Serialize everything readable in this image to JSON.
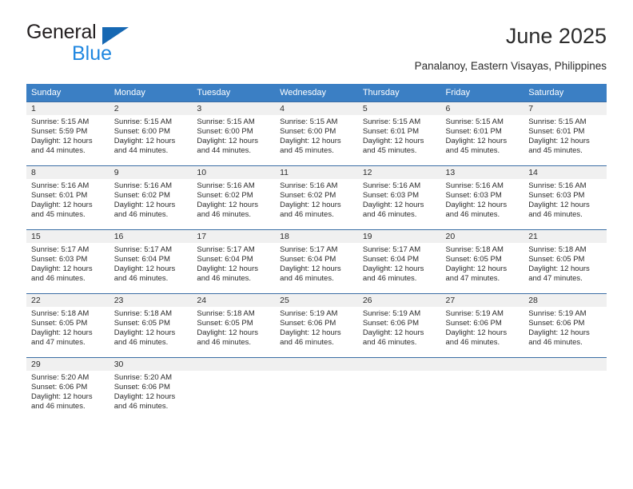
{
  "logo": {
    "primary_text": "General",
    "secondary_text": "Blue",
    "primary_color": "#231f20",
    "secondary_color": "#1f87e0",
    "triangle_color": "#1668b3",
    "icon": "triangle-flag-icon"
  },
  "header": {
    "title": "June 2025",
    "subtitle": "Panalanoy, Eastern Visayas, Philippines"
  },
  "colors": {
    "header_band": "#3b7fc4",
    "header_text": "#ffffff",
    "daynum_band": "#f0f0f0",
    "row_separator": "#3b6ea5",
    "body_text": "#2b2b2b"
  },
  "calendar": {
    "weekday_headers": [
      "Sunday",
      "Monday",
      "Tuesday",
      "Wednesday",
      "Thursday",
      "Friday",
      "Saturday"
    ],
    "weeks": [
      [
        {
          "day": "1",
          "sunrise": "Sunrise: 5:15 AM",
          "sunset": "Sunset: 5:59 PM",
          "daylight_line1": "Daylight: 12 hours",
          "daylight_line2": "and 44 minutes."
        },
        {
          "day": "2",
          "sunrise": "Sunrise: 5:15 AM",
          "sunset": "Sunset: 6:00 PM",
          "daylight_line1": "Daylight: 12 hours",
          "daylight_line2": "and 44 minutes."
        },
        {
          "day": "3",
          "sunrise": "Sunrise: 5:15 AM",
          "sunset": "Sunset: 6:00 PM",
          "daylight_line1": "Daylight: 12 hours",
          "daylight_line2": "and 44 minutes."
        },
        {
          "day": "4",
          "sunrise": "Sunrise: 5:15 AM",
          "sunset": "Sunset: 6:00 PM",
          "daylight_line1": "Daylight: 12 hours",
          "daylight_line2": "and 45 minutes."
        },
        {
          "day": "5",
          "sunrise": "Sunrise: 5:15 AM",
          "sunset": "Sunset: 6:01 PM",
          "daylight_line1": "Daylight: 12 hours",
          "daylight_line2": "and 45 minutes."
        },
        {
          "day": "6",
          "sunrise": "Sunrise: 5:15 AM",
          "sunset": "Sunset: 6:01 PM",
          "daylight_line1": "Daylight: 12 hours",
          "daylight_line2": "and 45 minutes."
        },
        {
          "day": "7",
          "sunrise": "Sunrise: 5:15 AM",
          "sunset": "Sunset: 6:01 PM",
          "daylight_line1": "Daylight: 12 hours",
          "daylight_line2": "and 45 minutes."
        }
      ],
      [
        {
          "day": "8",
          "sunrise": "Sunrise: 5:16 AM",
          "sunset": "Sunset: 6:01 PM",
          "daylight_line1": "Daylight: 12 hours",
          "daylight_line2": "and 45 minutes."
        },
        {
          "day": "9",
          "sunrise": "Sunrise: 5:16 AM",
          "sunset": "Sunset: 6:02 PM",
          "daylight_line1": "Daylight: 12 hours",
          "daylight_line2": "and 46 minutes."
        },
        {
          "day": "10",
          "sunrise": "Sunrise: 5:16 AM",
          "sunset": "Sunset: 6:02 PM",
          "daylight_line1": "Daylight: 12 hours",
          "daylight_line2": "and 46 minutes."
        },
        {
          "day": "11",
          "sunrise": "Sunrise: 5:16 AM",
          "sunset": "Sunset: 6:02 PM",
          "daylight_line1": "Daylight: 12 hours",
          "daylight_line2": "and 46 minutes."
        },
        {
          "day": "12",
          "sunrise": "Sunrise: 5:16 AM",
          "sunset": "Sunset: 6:03 PM",
          "daylight_line1": "Daylight: 12 hours",
          "daylight_line2": "and 46 minutes."
        },
        {
          "day": "13",
          "sunrise": "Sunrise: 5:16 AM",
          "sunset": "Sunset: 6:03 PM",
          "daylight_line1": "Daylight: 12 hours",
          "daylight_line2": "and 46 minutes."
        },
        {
          "day": "14",
          "sunrise": "Sunrise: 5:16 AM",
          "sunset": "Sunset: 6:03 PM",
          "daylight_line1": "Daylight: 12 hours",
          "daylight_line2": "and 46 minutes."
        }
      ],
      [
        {
          "day": "15",
          "sunrise": "Sunrise: 5:17 AM",
          "sunset": "Sunset: 6:03 PM",
          "daylight_line1": "Daylight: 12 hours",
          "daylight_line2": "and 46 minutes."
        },
        {
          "day": "16",
          "sunrise": "Sunrise: 5:17 AM",
          "sunset": "Sunset: 6:04 PM",
          "daylight_line1": "Daylight: 12 hours",
          "daylight_line2": "and 46 minutes."
        },
        {
          "day": "17",
          "sunrise": "Sunrise: 5:17 AM",
          "sunset": "Sunset: 6:04 PM",
          "daylight_line1": "Daylight: 12 hours",
          "daylight_line2": "and 46 minutes."
        },
        {
          "day": "18",
          "sunrise": "Sunrise: 5:17 AM",
          "sunset": "Sunset: 6:04 PM",
          "daylight_line1": "Daylight: 12 hours",
          "daylight_line2": "and 46 minutes."
        },
        {
          "day": "19",
          "sunrise": "Sunrise: 5:17 AM",
          "sunset": "Sunset: 6:04 PM",
          "daylight_line1": "Daylight: 12 hours",
          "daylight_line2": "and 46 minutes."
        },
        {
          "day": "20",
          "sunrise": "Sunrise: 5:18 AM",
          "sunset": "Sunset: 6:05 PM",
          "daylight_line1": "Daylight: 12 hours",
          "daylight_line2": "and 47 minutes."
        },
        {
          "day": "21",
          "sunrise": "Sunrise: 5:18 AM",
          "sunset": "Sunset: 6:05 PM",
          "daylight_line1": "Daylight: 12 hours",
          "daylight_line2": "and 47 minutes."
        }
      ],
      [
        {
          "day": "22",
          "sunrise": "Sunrise: 5:18 AM",
          "sunset": "Sunset: 6:05 PM",
          "daylight_line1": "Daylight: 12 hours",
          "daylight_line2": "and 47 minutes."
        },
        {
          "day": "23",
          "sunrise": "Sunrise: 5:18 AM",
          "sunset": "Sunset: 6:05 PM",
          "daylight_line1": "Daylight: 12 hours",
          "daylight_line2": "and 46 minutes."
        },
        {
          "day": "24",
          "sunrise": "Sunrise: 5:18 AM",
          "sunset": "Sunset: 6:05 PM",
          "daylight_line1": "Daylight: 12 hours",
          "daylight_line2": "and 46 minutes."
        },
        {
          "day": "25",
          "sunrise": "Sunrise: 5:19 AM",
          "sunset": "Sunset: 6:06 PM",
          "daylight_line1": "Daylight: 12 hours",
          "daylight_line2": "and 46 minutes."
        },
        {
          "day": "26",
          "sunrise": "Sunrise: 5:19 AM",
          "sunset": "Sunset: 6:06 PM",
          "daylight_line1": "Daylight: 12 hours",
          "daylight_line2": "and 46 minutes."
        },
        {
          "day": "27",
          "sunrise": "Sunrise: 5:19 AM",
          "sunset": "Sunset: 6:06 PM",
          "daylight_line1": "Daylight: 12 hours",
          "daylight_line2": "and 46 minutes."
        },
        {
          "day": "28",
          "sunrise": "Sunrise: 5:19 AM",
          "sunset": "Sunset: 6:06 PM",
          "daylight_line1": "Daylight: 12 hours",
          "daylight_line2": "and 46 minutes."
        }
      ],
      [
        {
          "day": "29",
          "sunrise": "Sunrise: 5:20 AM",
          "sunset": "Sunset: 6:06 PM",
          "daylight_line1": "Daylight: 12 hours",
          "daylight_line2": "and 46 minutes."
        },
        {
          "day": "30",
          "sunrise": "Sunrise: 5:20 AM",
          "sunset": "Sunset: 6:06 PM",
          "daylight_line1": "Daylight: 12 hours",
          "daylight_line2": "and 46 minutes."
        },
        {
          "day": "",
          "sunrise": "",
          "sunset": "",
          "daylight_line1": "",
          "daylight_line2": ""
        },
        {
          "day": "",
          "sunrise": "",
          "sunset": "",
          "daylight_line1": "",
          "daylight_line2": ""
        },
        {
          "day": "",
          "sunrise": "",
          "sunset": "",
          "daylight_line1": "",
          "daylight_line2": ""
        },
        {
          "day": "",
          "sunrise": "",
          "sunset": "",
          "daylight_line1": "",
          "daylight_line2": ""
        },
        {
          "day": "",
          "sunrise": "",
          "sunset": "",
          "daylight_line1": "",
          "daylight_line2": ""
        }
      ]
    ]
  }
}
